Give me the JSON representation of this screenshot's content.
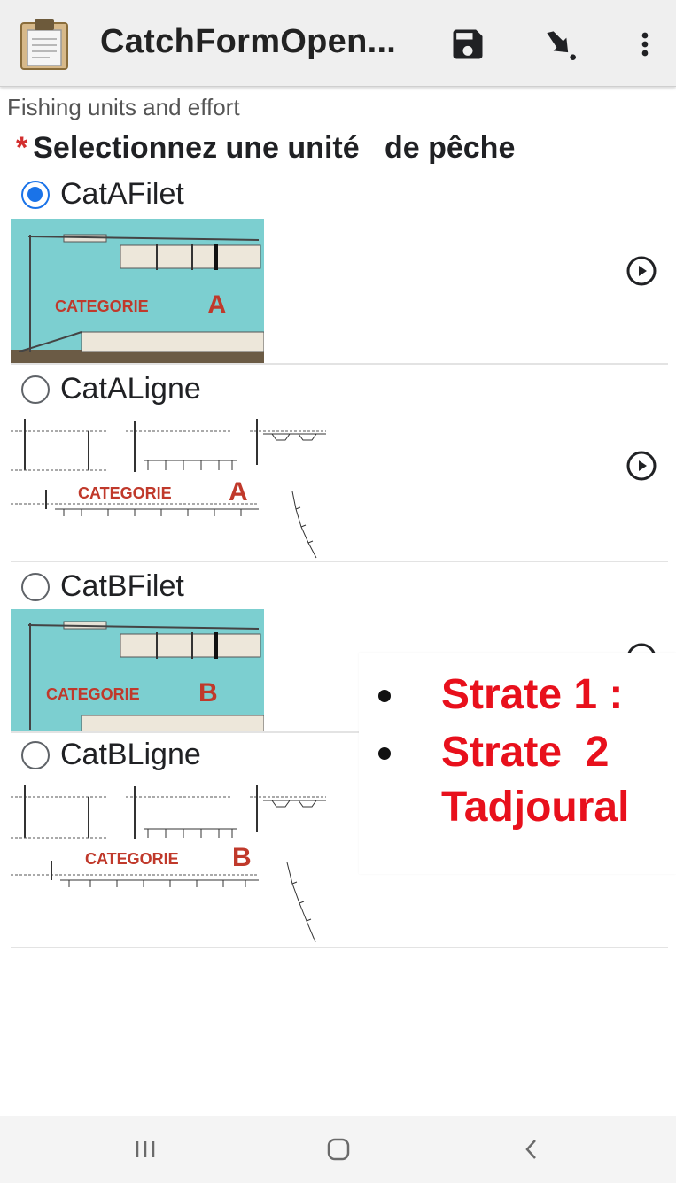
{
  "app": {
    "title": "CatchFormOpen...",
    "icons": {
      "app": "clipboard-icon",
      "save": "save-icon",
      "goto": "goto-arrow-icon",
      "more": "more-vert-icon"
    }
  },
  "form": {
    "section_title": "Fishing units and effort",
    "question": {
      "required_mark": "*",
      "label": "Selectionnez une unité   de pêche"
    },
    "choices": [
      {
        "label": "CatAFilet",
        "selected": true,
        "image_caption_word": "CATEGORIE",
        "image_caption_letter": "A"
      },
      {
        "label": "CatALigne",
        "selected": false,
        "image_caption_word": "CATEGORIE",
        "image_caption_letter": "A"
      },
      {
        "label": "CatBFilet",
        "selected": false,
        "image_caption_word": "CATEGORIE",
        "image_caption_letter": "B"
      },
      {
        "label": "CatBLigne",
        "selected": false,
        "image_caption_word": "CATEGORIE",
        "image_caption_letter": "B"
      }
    ]
  },
  "overlay": {
    "lines": [
      "Strate 1 :",
      "Strate  2",
      "Tadjoural"
    ]
  },
  "colors": {
    "accent": "#1a73e8",
    "required": "#d32f2f",
    "overlay_text": "#e8101c",
    "water": "#7ccfd0"
  },
  "nav": {
    "icons": [
      "recent-apps-icon",
      "home-icon",
      "back-icon"
    ]
  }
}
